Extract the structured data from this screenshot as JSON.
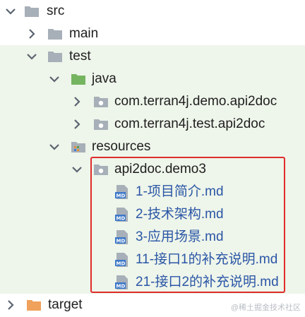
{
  "tree": {
    "src": "src",
    "main": "main",
    "test": "test",
    "java": "java",
    "pkg1": "com.terran4j.demo.api2doc",
    "pkg2": "com.terran4j.test.api2doc",
    "resources": "resources",
    "api2doc_folder": "api2doc.demo3",
    "files": [
      "1-项目简介.md",
      "2-技术架构.md",
      "3-应用场景.md",
      "11-接口1的补充说明.md",
      "21-接口2的补充说明.md"
    ],
    "target": "target"
  },
  "icons": {
    "folder": "folder-icon",
    "package": "package-icon",
    "resources": "resources-folder-icon",
    "markdown": "markdown-file-icon",
    "arrow_expanded": "chevron-down-icon",
    "arrow_collapsed": "chevron-right-icon"
  },
  "colors": {
    "test_background": "#eef5ea",
    "highlight_border": "#e02b2b",
    "md_label": "#2a56a6",
    "java_folder": "#75b560",
    "target_folder": "#f0a15b"
  },
  "watermark": "@稀土掘金技术社区"
}
